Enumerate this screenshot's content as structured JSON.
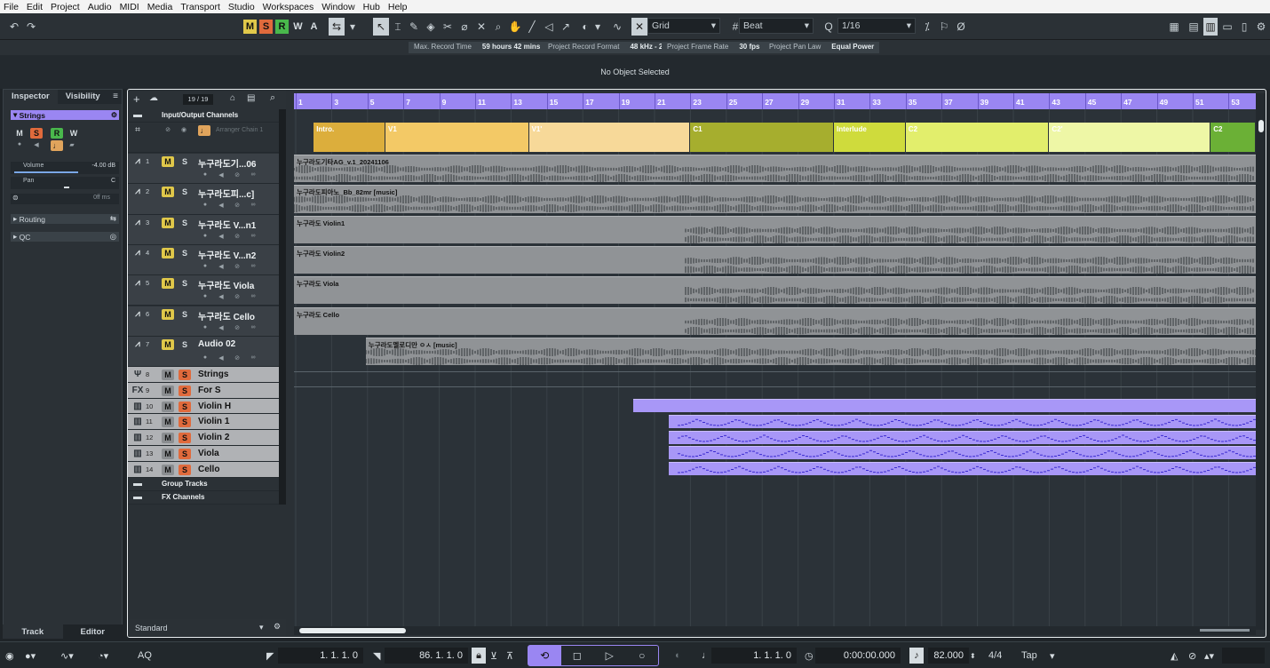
{
  "menu": [
    "File",
    "Edit",
    "Project",
    "Audio",
    "MIDI",
    "Media",
    "Transport",
    "Studio",
    "Workspaces",
    "Window",
    "Hub",
    "Help"
  ],
  "toolbar": {
    "mute_all": "M",
    "solo_all": "S",
    "read_all": "R",
    "write_all": "W",
    "auto": "A",
    "snap_type": "Grid",
    "grid_type": "Beat",
    "quantize": "1/16"
  },
  "info": [
    {
      "k": "Max. Record Time",
      "v": "59 hours 42 mins"
    },
    {
      "k": "Project Record Format",
      "v": "48 kHz - 24 bit"
    },
    {
      "k": "Project Frame Rate",
      "v": "30 fps"
    },
    {
      "k": "Project Pan Law",
      "v": "Equal Power"
    }
  ],
  "info_line": "No Object Selected",
  "inspector": {
    "tabs": [
      "Inspector",
      "Visibility"
    ],
    "track_name": "Strings",
    "buttons": [
      "M",
      "S",
      "R",
      "W"
    ],
    "volume_label": "Volume",
    "volume_value": "-4.00 dB",
    "pan_label": "Pan",
    "pan_value": "C",
    "delay_value": "0ff ms",
    "sections": [
      "Routing",
      "QC"
    ],
    "bottom_tabs": [
      "Track",
      "Editor"
    ]
  },
  "tracklist": {
    "count": "19 / 19",
    "folder_top": "Input/Output Channels",
    "arranger_name": "Arranger Chain 1",
    "tracks": [
      {
        "num": "1",
        "name": "누구라도기...06"
      },
      {
        "num": "2",
        "name": "누구라도피...c]"
      },
      {
        "num": "3",
        "name": "누구라도 V...n1"
      },
      {
        "num": "4",
        "name": "누구라도 V...n2"
      },
      {
        "num": "5",
        "name": "누구라도 Viola"
      },
      {
        "num": "6",
        "name": "누구라도 Cello"
      },
      {
        "num": "7",
        "name": "Audio 02"
      },
      {
        "num": "8",
        "name": "Strings"
      },
      {
        "num": "9",
        "name": "For S"
      },
      {
        "num": "10",
        "name": "Violin H"
      },
      {
        "num": "11",
        "name": "Violin 1"
      },
      {
        "num": "12",
        "name": "Violin 2"
      },
      {
        "num": "13",
        "name": "Viola"
      },
      {
        "num": "14",
        "name": "Cello"
      }
    ],
    "group_tracks": "Group Tracks",
    "fx_channels": "FX Channels",
    "footer": "Standard"
  },
  "ruler": [
    "1",
    "3",
    "5",
    "7",
    "9",
    "11",
    "13",
    "15",
    "17",
    "19",
    "21",
    "23",
    "25",
    "27",
    "29",
    "31",
    "33",
    "35",
    "37",
    "39",
    "41",
    "43",
    "45",
    "47",
    "49",
    "51",
    "53"
  ],
  "arranger": [
    {
      "label": "Intro.",
      "start": 2,
      "end": 6,
      "color": "#dcae3c"
    },
    {
      "label": "V1",
      "start": 6,
      "end": 14,
      "color": "#f3c966"
    },
    {
      "label": "V1'",
      "start": 14,
      "end": 23,
      "color": "#f7d999"
    },
    {
      "label": "C1",
      "start": 23,
      "end": 31,
      "color": "#a6ae2e"
    },
    {
      "label": "Interlude",
      "start": 31,
      "end": 35,
      "color": "#cfdb3c"
    },
    {
      "label": "C2",
      "start": 35,
      "end": 43,
      "color": "#e2ee6c"
    },
    {
      "label": "C2'",
      "start": 43,
      "end": 52,
      "color": "#eef7a6"
    },
    {
      "label": "C2",
      "start": 52,
      "end": 55,
      "color": "#6bb036"
    }
  ],
  "audio_regions": [
    {
      "label": "누구라도기타AG_v.1_20241106",
      "start": 1,
      "end": 55
    },
    {
      "label": "누구라도피아노_Bb_82mr [music]",
      "start": 1,
      "end": 55
    },
    {
      "label": "누구라도 Violin1",
      "start": 1,
      "end": 55
    },
    {
      "label": "누구라도 Violin2",
      "start": 1,
      "end": 55
    },
    {
      "label": "누구라도 Viola",
      "start": 1,
      "end": 55
    },
    {
      "label": "누구라도 Cello",
      "start": 1,
      "end": 55
    },
    {
      "label": "누구라도멜로디만 ㅇㅅ [music]",
      "start": 5,
      "end": 55
    }
  ],
  "midi_regions": [
    {
      "start": 20,
      "end": 55
    },
    {
      "start": 22,
      "end": 55
    },
    {
      "start": 22,
      "end": 55
    },
    {
      "start": 22,
      "end": 55
    },
    {
      "start": 22,
      "end": 55
    }
  ],
  "status": {
    "left_locator": "1. 1. 1.   0",
    "right_locator": "86. 1. 1.   0",
    "position": "1. 1. 1.   0",
    "time": "0:00:00.000",
    "tempo": "82.000",
    "signature": "4/4",
    "tap": "Tap",
    "aq": "AQ"
  }
}
